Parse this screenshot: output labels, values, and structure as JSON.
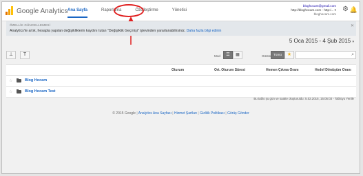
{
  "app": {
    "logo_text": "Google Analytics"
  },
  "nav": [
    {
      "label": "Ana Sayfa",
      "active": true
    },
    {
      "label": "Raporlama",
      "active": false
    },
    {
      "label": "Özelleştirme",
      "active": false
    },
    {
      "label": "Yönetici",
      "active": false
    }
  ],
  "account": {
    "email": "bloghocam@gmail.com",
    "property": "http://bloghocam.com - http:/... ▾",
    "site": "bloghocam.com"
  },
  "notice": {
    "head": "ÖZELLİK GÜNCELLEMESİ",
    "body": "Analytics'te artık, hesapta yapılan değişikliklerin kaydını tutan \"Değişiklik Geçmişi\" işlevinden yararlanabilirsiniz.",
    "link": "Daha fazla bilgi edinin"
  },
  "date_range": "5 Oca 2015 - 4 Şub 2015",
  "toolbar": {
    "mode_label": "Mod",
    "show_label": "Göster",
    "show_all": "Tümü"
  },
  "table": {
    "headers": [
      "Oturum",
      "Ort. Oturum Süresi",
      "Hemen Çıkma Oranı",
      "Hedef Dönüşüm Oranı"
    ],
    "rows": [
      {
        "name": "Blog Hocam"
      },
      {
        "name": "Blog Hocam Test"
      }
    ]
  },
  "updated_note": "Bu tablo şu gün ve saatte oluşturuldu: 5.02.2015, 15:05:03 - Tabloyu Yenile",
  "footer": {
    "copyright": "© 2015 Google",
    "links": [
      "Analytics Ana Sayfası",
      "Hizmet Şartları",
      "Gizlilik Politikası",
      "Görüş Gönder"
    ]
  },
  "colors": {
    "accent": "#1a66c4",
    "annotation": "#e02020"
  }
}
